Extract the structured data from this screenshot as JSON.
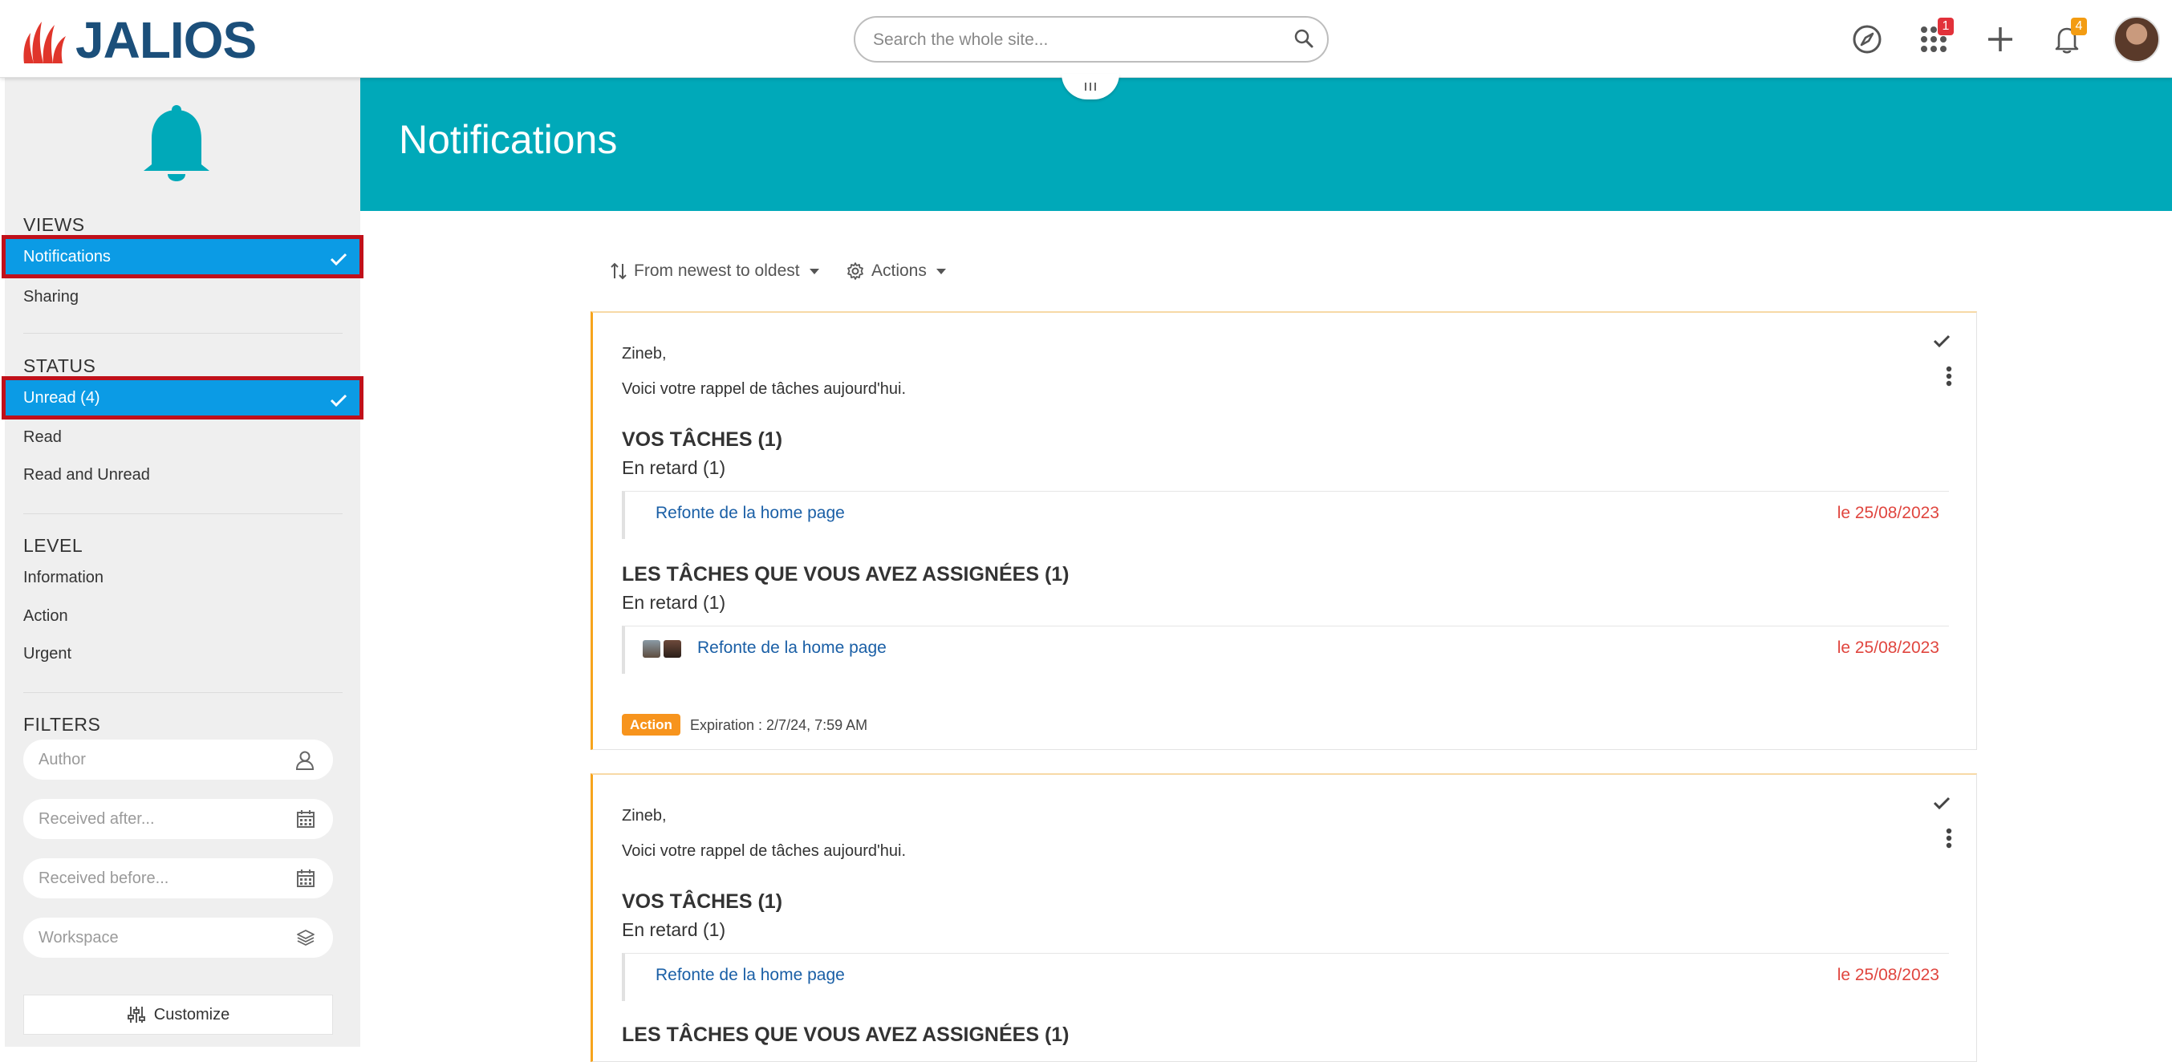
{
  "header": {
    "logo_text": "JALIOS",
    "search_placeholder": "Search the whole site...",
    "apps_badge": "1",
    "notifications_badge": "4",
    "colors": {
      "brand_red": "#e0352b",
      "brand_blue": "#1b4f7a",
      "badge_red": "#e2313a",
      "badge_orange": "#f39c12"
    }
  },
  "sidebar": {
    "views_title": "VIEWS",
    "views": [
      {
        "label": "Notifications",
        "selected": true
      },
      {
        "label": "Sharing",
        "selected": false
      }
    ],
    "status_title": "STATUS",
    "status": [
      {
        "label": "Unread (4)",
        "selected": true
      },
      {
        "label": "Read",
        "selected": false
      },
      {
        "label": "Read and Unread",
        "selected": false
      }
    ],
    "level_title": "LEVEL",
    "levels": [
      {
        "label": "Information"
      },
      {
        "label": "Action"
      },
      {
        "label": "Urgent"
      }
    ],
    "filters_title": "FILTERS",
    "filters": [
      {
        "placeholder": "Author",
        "icon": "user-icon"
      },
      {
        "placeholder": "Received after...",
        "icon": "calendar-icon"
      },
      {
        "placeholder": "Received before...",
        "icon": "calendar-icon"
      },
      {
        "placeholder": "Workspace",
        "icon": "layers-icon"
      }
    ],
    "customize_label": "Customize"
  },
  "main": {
    "title": "Notifications",
    "sort_label": "From newest to oldest",
    "actions_label": "Actions",
    "accent_color": "#00a9b9"
  },
  "cards": [
    {
      "greeting": "Zineb,",
      "intro": "Voici votre rappel de tâches aujourd'hui.",
      "your_tasks_title": "VOS TÂCHES (1)",
      "your_tasks_sub": "En retard (1)",
      "your_task": {
        "label": "Refonte de la home page",
        "date": "le 25/08/2023"
      },
      "assigned_title": "LES TÂCHES QUE VOUS AVEZ ASSIGNÉES (1)",
      "assigned_sub": "En retard (1)",
      "assigned_task": {
        "label": "Refonte de la home page",
        "date": "le 25/08/2023"
      },
      "level_badge": "Action",
      "expiration": "Expiration : 2/7/24, 7:59 AM"
    },
    {
      "greeting": "Zineb,",
      "intro": "Voici votre rappel de tâches aujourd'hui.",
      "your_tasks_title": "VOS TÂCHES (1)",
      "your_tasks_sub": "En retard (1)",
      "your_task": {
        "label": "Refonte de la home page",
        "date": "le 25/08/2023"
      },
      "assigned_title": "LES TÂCHES QUE VOUS AVEZ ASSIGNÉES (1)"
    }
  ]
}
